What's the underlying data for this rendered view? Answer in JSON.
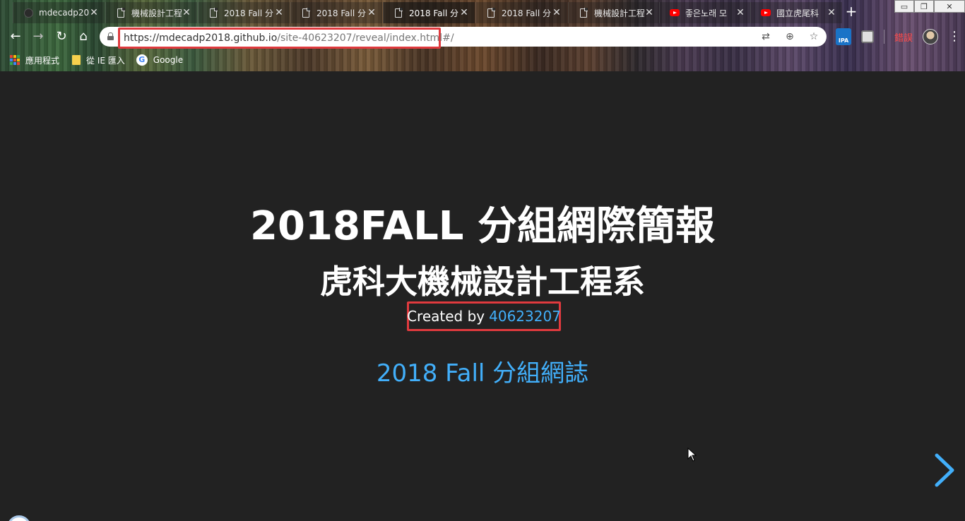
{
  "browser": {
    "tabs": [
      {
        "icon": "github-icon",
        "title": "mdecadp20",
        "active": false
      },
      {
        "icon": "document-icon",
        "title": "機械設計工程",
        "active": false
      },
      {
        "icon": "document-icon",
        "title": "2018 Fall 分",
        "active": false
      },
      {
        "icon": "document-icon",
        "title": "2018 Fall 分",
        "active": false
      },
      {
        "icon": "document-icon",
        "title": "2018 Fall 分",
        "active": true
      },
      {
        "icon": "document-icon",
        "title": "2018 Fall 分",
        "active": false
      },
      {
        "icon": "document-icon",
        "title": "機械設計工程",
        "active": false
      },
      {
        "icon": "youtube-icon",
        "title": "좋은노래 모",
        "active": false
      },
      {
        "icon": "youtube-icon",
        "title": "國立虎尾科",
        "active": false
      }
    ],
    "new_tab_label": "+",
    "window_controls": {
      "minimize": "▭",
      "restore": "❐",
      "close": "✕"
    },
    "toolbar": {
      "back": "←",
      "forward": "→",
      "reload": "↻",
      "home": "⌂"
    },
    "address": {
      "host": "https://mdecadp2018.github.io",
      "path": "/site-40623207/reveal/index.html#/"
    },
    "omnibox_icons": [
      "translate-icon",
      "zoom-icon",
      "bookmark-star-icon"
    ],
    "extensions": {
      "ipa_label": "IPA",
      "error_label": "錯誤"
    },
    "bookmarks": [
      {
        "icon": "apps-icon",
        "label": "應用程式"
      },
      {
        "icon": "folder-icon",
        "label": "從 IE 匯入"
      },
      {
        "icon": "google-icon",
        "label": "Google"
      }
    ],
    "highlight_color": "#e03a3e"
  },
  "slide": {
    "title": "2018FALL 分組網際簡報",
    "subtitle": "虎科大機械設計工程系",
    "created_by_label": "Created by",
    "created_by_link": "40623207",
    "blog_link": "2018 Fall 分組網誌",
    "background": "#222222",
    "link_color": "#42affa"
  }
}
